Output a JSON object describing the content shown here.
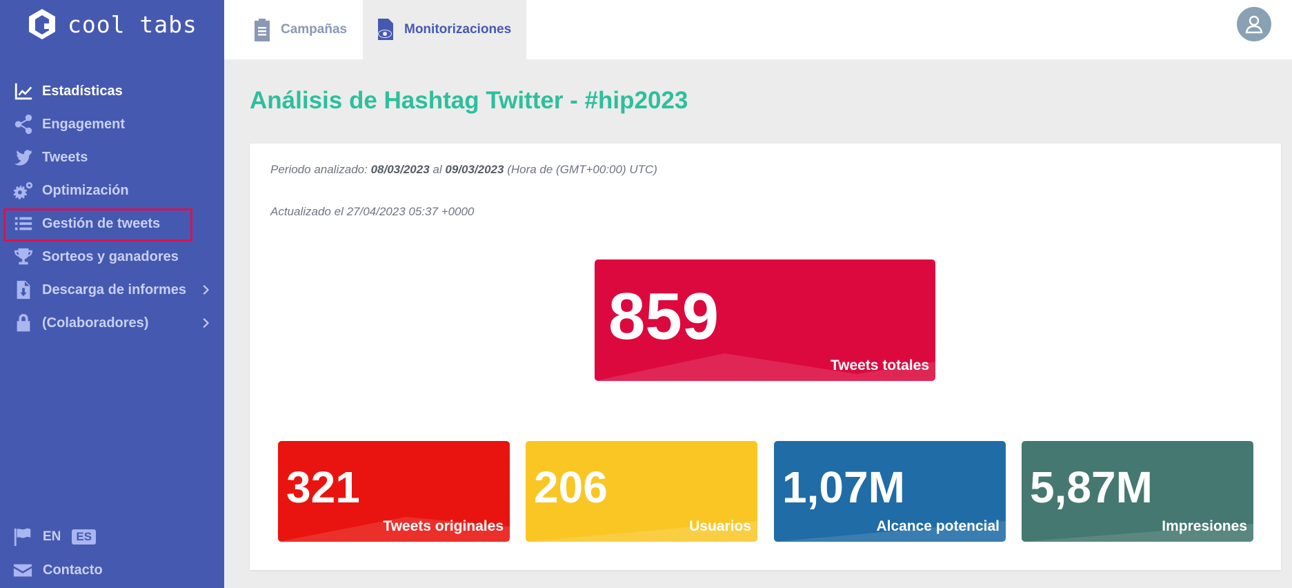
{
  "brand": {
    "name": "cool tabs"
  },
  "sidebar": {
    "items": [
      {
        "label": "Estadísticas",
        "icon": "chart-line-icon",
        "active": true
      },
      {
        "label": "Engagement",
        "icon": "share-icon"
      },
      {
        "label": "Tweets",
        "icon": "twitter-icon"
      },
      {
        "label": "Optimización",
        "icon": "gears-icon"
      },
      {
        "label": "Gestión de tweets",
        "icon": "list-icon",
        "highlighted": true
      },
      {
        "label": "Sorteos y ganadores",
        "icon": "trophy-icon"
      },
      {
        "label": "Descarga de informes",
        "icon": "download-file-icon",
        "has_submenu": true
      },
      {
        "label": "(Colaboradores)",
        "icon": "lock-icon",
        "has_submenu": true
      }
    ],
    "languages": {
      "en": "EN",
      "es": "ES",
      "selected": "ES"
    },
    "contact": "Contacto"
  },
  "topbar": {
    "tabs": [
      {
        "label": "Campañas",
        "icon": "clipboard-icon"
      },
      {
        "label": "Monitorizaciones",
        "icon": "eye-document-icon",
        "active": true
      }
    ]
  },
  "main": {
    "title": "Análisis de Hashtag Twitter - #hip2023",
    "period": {
      "prefix": "Periodo analizado:",
      "from": "08/03/2023",
      "connector": "al",
      "to": "09/03/2023",
      "timezone": "(Hora de (GMT+00:00) UTC)"
    },
    "updated": "Actualizado el 27/04/2023 05:37 +0000",
    "stats": {
      "total": {
        "value": "859",
        "label": "Tweets totales",
        "color": "#dc093e"
      },
      "original": {
        "value": "321",
        "label": "Tweets originales",
        "color": "#e9140f"
      },
      "users": {
        "value": "206",
        "label": "Usuarios",
        "color": "#f9c623"
      },
      "reach": {
        "value": "1,07M",
        "label": "Alcance potencial",
        "color": "#1f6ca6"
      },
      "impressions": {
        "value": "5,87M",
        "label": "Impresiones",
        "color": "#447870"
      }
    }
  },
  "colors": {
    "sidebar": "#4659b0",
    "title": "#2dbf9c",
    "highlight": "#d81350"
  }
}
